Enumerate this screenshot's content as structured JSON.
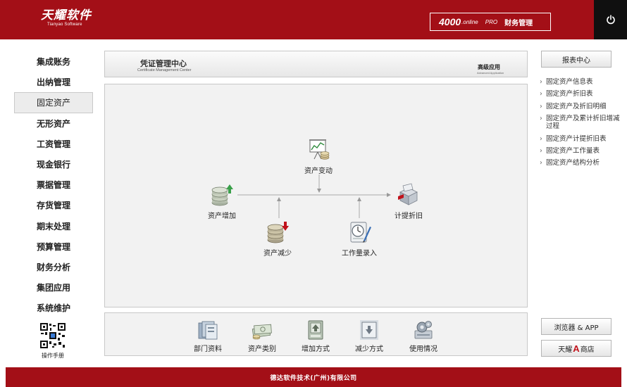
{
  "header": {
    "logo_cn": "天耀软件",
    "logo_en": "Tianyao Software",
    "product_number": "4000",
    "product_online": ".online",
    "product_pro": "PRO",
    "product_title": "财务管理",
    "power_icon": "power-icon"
  },
  "sidebar": {
    "items": [
      {
        "label": "集成账务"
      },
      {
        "label": "出纳管理"
      },
      {
        "label": "固定资产",
        "active": true
      },
      {
        "label": "无形资产"
      },
      {
        "label": "工资管理"
      },
      {
        "label": "现金银行"
      },
      {
        "label": "票据管理"
      },
      {
        "label": "存货管理"
      },
      {
        "label": "期末处理"
      },
      {
        "label": "预算管理"
      },
      {
        "label": "财务分析"
      },
      {
        "label": "集团应用"
      },
      {
        "label": "系统维护"
      }
    ],
    "qr_label": "操作手册"
  },
  "title_bar": {
    "title_cn": "凭证管理中心",
    "title_en": "Certificate Management Center",
    "advanced_cn": "高级应用",
    "advanced_en": "Advanced Application"
  },
  "flow": {
    "nodes": [
      {
        "label": "资产变动",
        "icon": "asset-change-chart-icon"
      },
      {
        "label": "资产增加",
        "icon": "coin-stack-up-icon"
      },
      {
        "label": "计提折旧",
        "icon": "depreciation-box-icon"
      },
      {
        "label": "资产减少",
        "icon": "coin-stack-down-icon"
      },
      {
        "label": "工作量录入",
        "icon": "clock-notepad-icon"
      }
    ]
  },
  "toolbar": {
    "items": [
      {
        "label": "部门资料",
        "icon": "department-folder-icon"
      },
      {
        "label": "资产类别",
        "icon": "asset-category-money-icon"
      },
      {
        "label": "增加方式",
        "icon": "add-method-icon"
      },
      {
        "label": "减少方式",
        "icon": "reduce-method-icon"
      },
      {
        "label": "使用情况",
        "icon": "usage-gears-icon"
      }
    ]
  },
  "right_panel": {
    "report_center": "报表中心",
    "arrow": "›",
    "reports": [
      "固定资产信息表",
      "固定资产折旧表",
      "固定资产及折旧明细",
      "固定资产及累计折旧增减过程",
      "固定资产计提折旧表",
      "固定资产工作量表",
      "固定资产结构分析"
    ],
    "browser_app": "浏览器 & APP",
    "store_pre": "天耀",
    "store_a": "A",
    "store_post": "商店"
  },
  "colors": {
    "brand_red": "#a30f17",
    "power_bg": "#101010",
    "panel_bg": "#f2f2f2"
  },
  "footer": {
    "text": "德达软件技术(广州)有限公司"
  }
}
